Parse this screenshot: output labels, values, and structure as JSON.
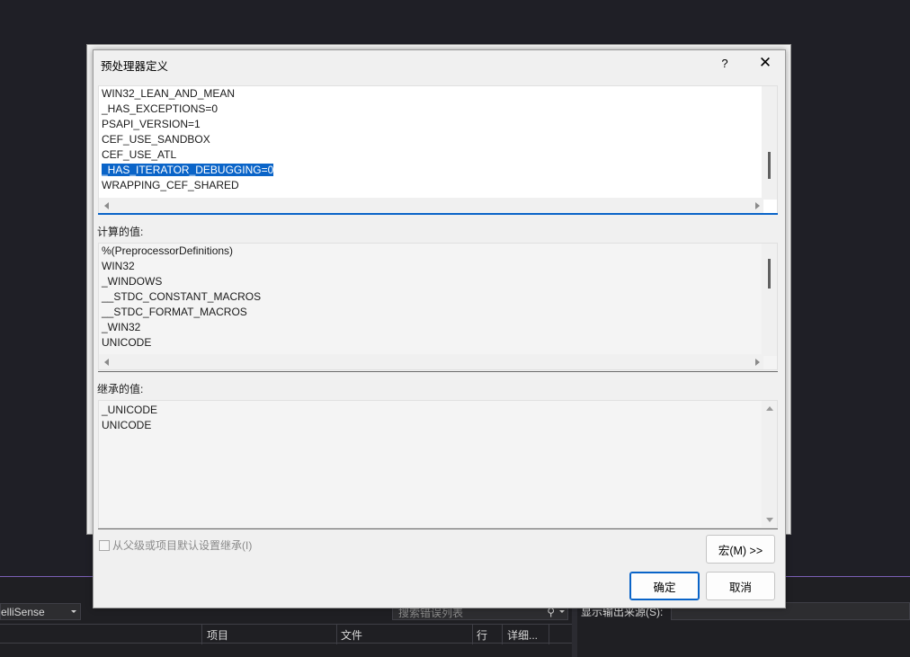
{
  "dialog": {
    "title": "预处理器定义",
    "help_label": "?",
    "close_label": "✕",
    "definitions": [
      "WIN32_LEAN_AND_MEAN",
      "_HAS_EXCEPTIONS=0",
      "PSAPI_VERSION=1",
      "CEF_USE_SANDBOX",
      "CEF_USE_ATL",
      "_HAS_ITERATOR_DEBUGGING=0",
      "WRAPPING_CEF_SHARED"
    ],
    "selected_definition": "_HAS_ITERATOR_DEBUGGING=0",
    "computed_label": "计算的值:",
    "computed_values": [
      "%(PreprocessorDefinitions)",
      "WIN32",
      "_WINDOWS",
      "__STDC_CONSTANT_MACROS",
      "__STDC_FORMAT_MACROS",
      "_WIN32",
      "UNICODE"
    ],
    "inherited_label": "继承的值:",
    "inherited_values": [
      "_UNICODE",
      "UNICODE"
    ],
    "inherit_checkbox_label": "从父级或项目默认设置继承(I)",
    "inherit_checked": false,
    "macros_button": "宏(M) >>",
    "ok_button": "确定",
    "cancel_button": "取消"
  },
  "ide": {
    "config_combo": "elliSense",
    "search_placeholder": "搜索错误列表",
    "search_icon": "magnifier-icon",
    "columns": [
      "项目",
      "文件",
      "行",
      "详细..."
    ],
    "output_source_label": "显示输出来源(S):"
  },
  "colors": {
    "accent": "#0a64c8",
    "ide_background": "#1f1f26",
    "dialog_background": "#f0f0f0"
  }
}
